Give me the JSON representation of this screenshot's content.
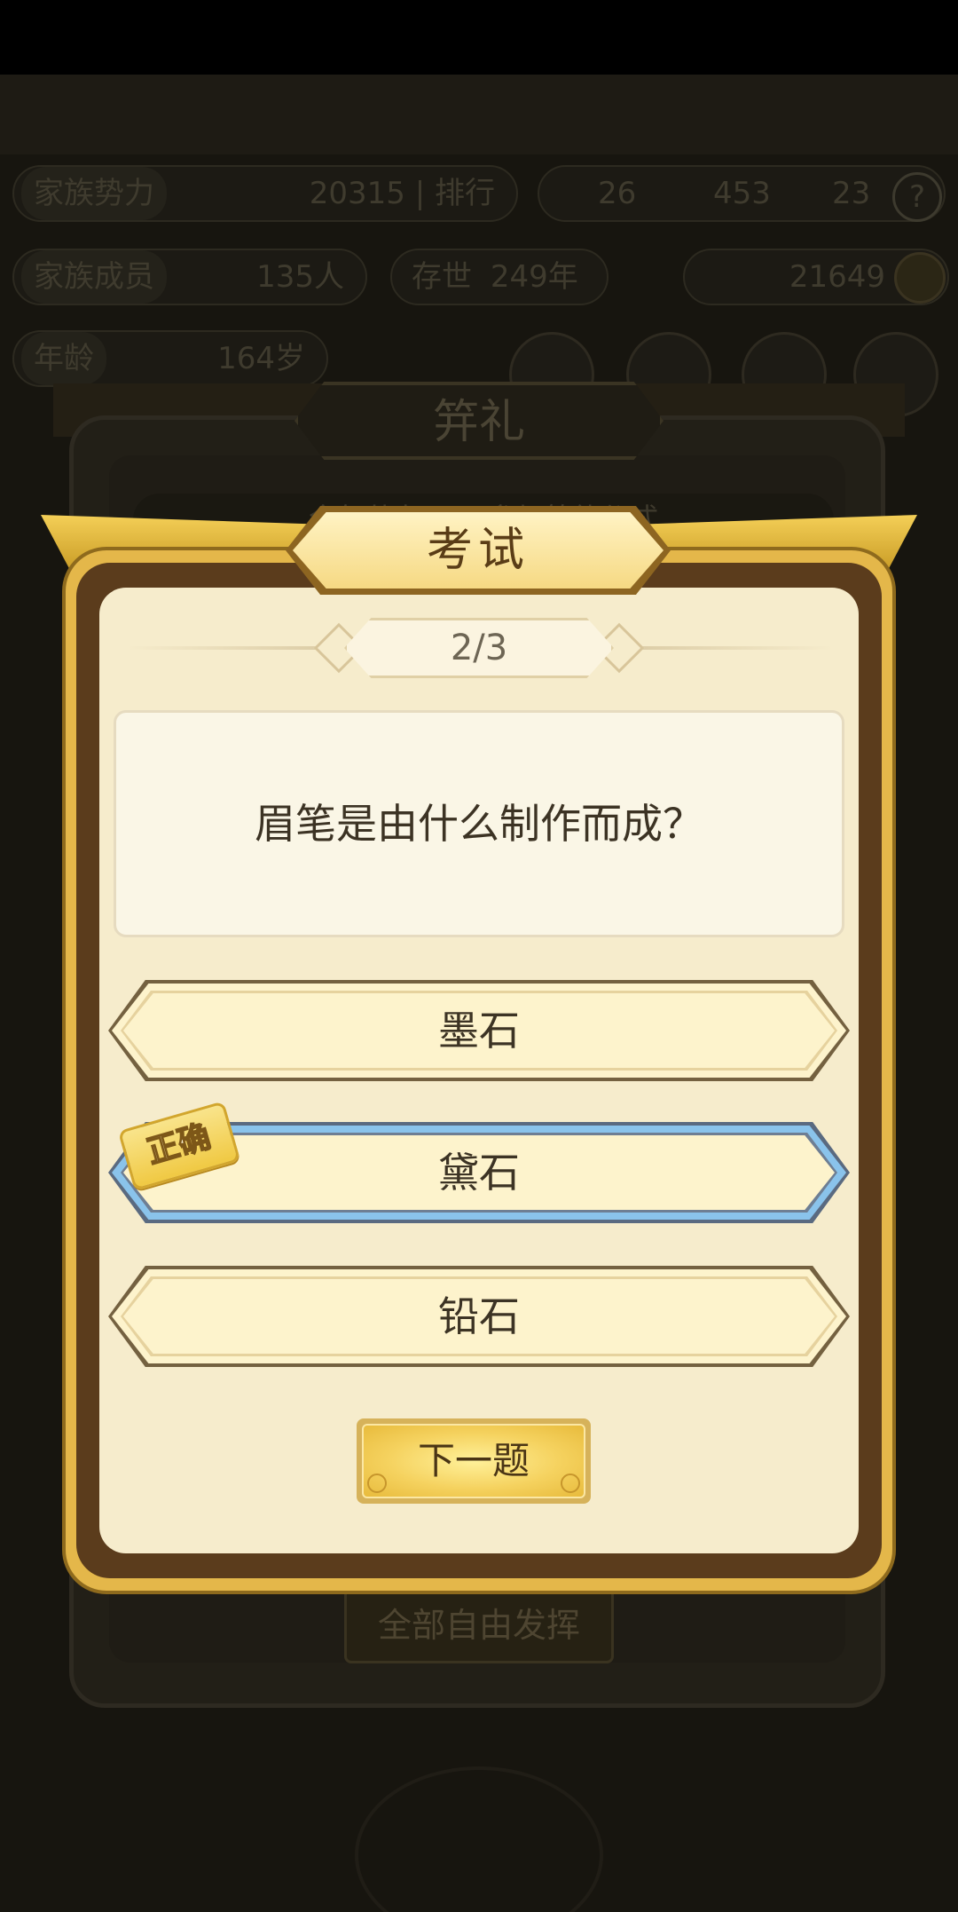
{
  "background": {
    "stats": [
      {
        "label": "家族势力",
        "value": "20315 | 排行"
      },
      {
        "label": "家族成员",
        "value": "135人"
      },
      {
        "label": "存世",
        "value": "249年"
      },
      {
        "label": "年龄",
        "value": "164岁"
      }
    ],
    "resources": {
      "a": "26",
      "b": "453",
      "c": "23"
    },
    "coins": "21649",
    "help_symbol": "?",
    "back_dialog": {
      "title": "笄礼",
      "description": "今年共有____ 参加笄礼仪式",
      "free_button": "全部自由发挥"
    }
  },
  "modal": {
    "title": "考试",
    "progress": "2/3",
    "question": "眉笔是由什么制作而成？",
    "options": [
      {
        "label": "墨石",
        "selected": false
      },
      {
        "label": "黛石",
        "selected": true
      },
      {
        "label": "铅石",
        "selected": false
      }
    ],
    "correct_badge": "正确",
    "next_button": "下一题"
  },
  "colors": {
    "accent_gold": "#f0c943",
    "selected_border": "#8ac3eb",
    "panel_bg": "#f6eccc"
  }
}
